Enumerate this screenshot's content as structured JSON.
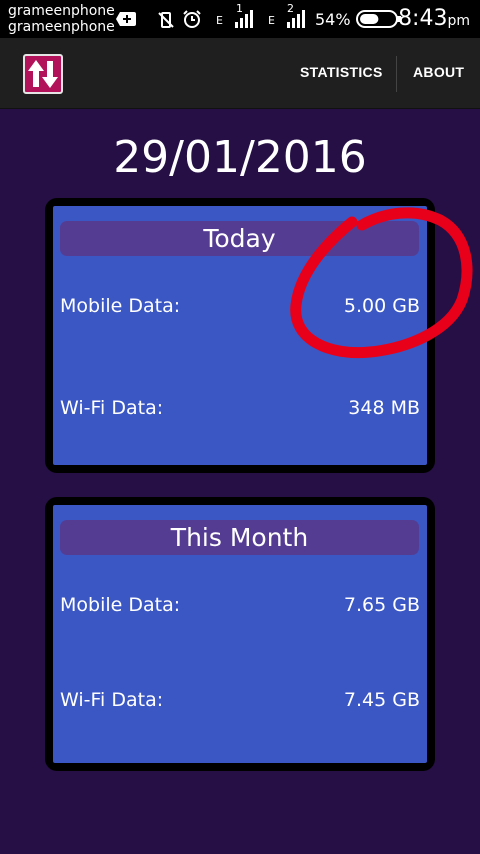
{
  "status_bar": {
    "carrier_1": "grameenphone",
    "carrier_2": "grameenphone",
    "network_1_label": "E",
    "sim_1": "1",
    "network_2_label": "E",
    "sim_2": "2",
    "battery_percent": "54%",
    "battery_level": 0.54,
    "time": "8:43",
    "ampm": "pm"
  },
  "action_bar": {
    "statistics_label": "STATISTICS",
    "about_label": "ABOUT"
  },
  "date": "29/01/2016",
  "today": {
    "title": "Today",
    "mobile_label": "Mobile Data:",
    "mobile_value": "5.00 GB",
    "wifi_label": "Wi-Fi Data:",
    "wifi_value": "348 MB"
  },
  "month": {
    "title": "This Month",
    "mobile_label": "Mobile Data:",
    "mobile_value": "7.65 GB",
    "wifi_label": "Wi-Fi Data:",
    "wifi_value": "7.45 GB"
  },
  "colors": {
    "background": "#250f45",
    "card": "#3b57c4",
    "card_title": "#553c93",
    "app_icon": "#b2125a",
    "annotation": "#e8001a"
  }
}
